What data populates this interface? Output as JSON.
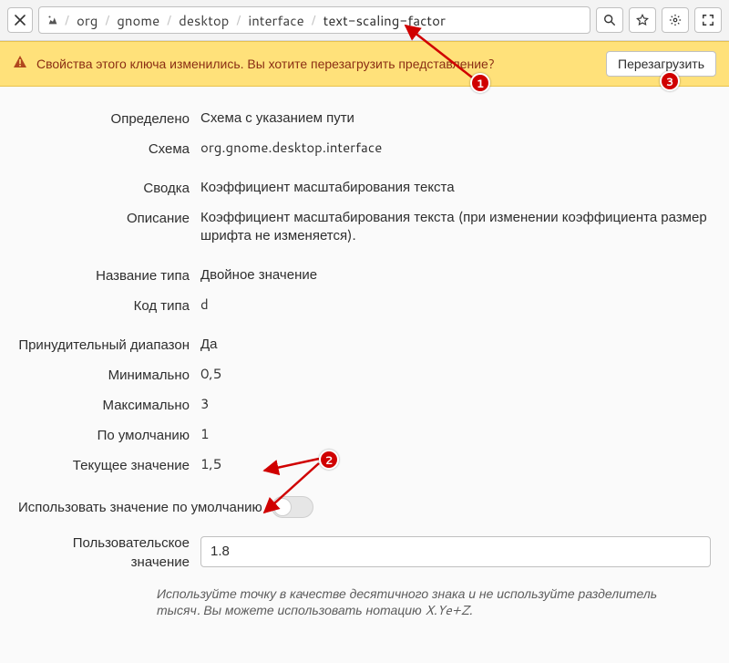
{
  "breadcrumb": {
    "items": [
      "org",
      "gnome",
      "desktop",
      "interface",
      "text-scaling-factor"
    ]
  },
  "banner": {
    "message": "Свойства этого ключа изменились. Вы хотите перезагрузить представление?",
    "reload_button": "Перезагрузить"
  },
  "details": {
    "defined_label": "Определено",
    "defined_value": "Схема с указанием пути",
    "schema_label": "Схема",
    "schema_value": "org.gnome.desktop.interface",
    "summary_label": "Сводка",
    "summary_value": "Коэффициент масштабирования текста",
    "description_label": "Описание",
    "description_value": "Коэффициент масштабирования текста (при изменении коэффициента размер шрифта не изменяется).",
    "type_label": "Название типа",
    "type_value": "Двойное значение",
    "type_code_label": "Код типа",
    "type_code_value": "d",
    "forced_range_label": "Принудительный диапазон",
    "forced_range_value": "Да",
    "min_label": "Минимально",
    "min_value": "0,5",
    "max_label": "Максимально",
    "max_value": "3",
    "default_label": "По умолчанию",
    "default_value": "1",
    "current_label": "Текущее значение",
    "current_value": "1,5"
  },
  "edit": {
    "use_default_label": "Использовать значение по умолчанию",
    "custom_value_label": "Пользовательское значение",
    "custom_value": "1.8",
    "hint": "Используйте точку в качестве десятичного знака и не используйте разделитель тысяч. Вы можете использовать нотацию X.Ye+Z."
  },
  "annotations": {
    "b1": "1",
    "b2": "2",
    "b3": "3"
  }
}
